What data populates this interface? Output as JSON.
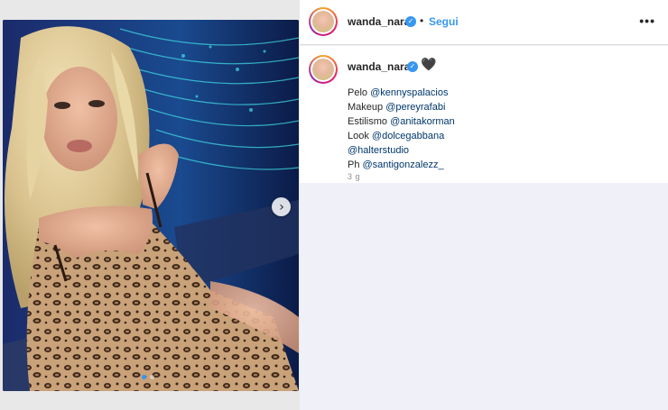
{
  "post": {
    "username": "wanda_nara",
    "separator": "•",
    "follow_label": "Segui",
    "more_label": "•••",
    "verified_glyph": "✓",
    "heart_glyph": "🖤",
    "next_glyph": "›",
    "caption": [
      {
        "prefix": "Pelo ",
        "mention": "@kennyspalacios"
      },
      {
        "prefix": "Makeup ",
        "mention": "@pereyrafabi"
      },
      {
        "prefix": "Estilismo ",
        "mention": "@anitakorman"
      },
      {
        "prefix": "Look ",
        "mention": "@dolcegabbana"
      },
      {
        "prefix": "",
        "mention": "@halterstudio"
      },
      {
        "prefix": "Ph ",
        "mention": "@santigonzalezz_"
      }
    ],
    "time": "3 g",
    "carousel": {
      "count": 2,
      "active_index": 0
    }
  },
  "colors": {
    "accent": "#3897f0",
    "mention": "#00376b",
    "side_background": "#eff0f8"
  },
  "icons": {
    "verified": "verified-badge-icon",
    "next": "chevron-right-icon",
    "more": "more-options-icon",
    "heart": "black-heart-icon"
  }
}
